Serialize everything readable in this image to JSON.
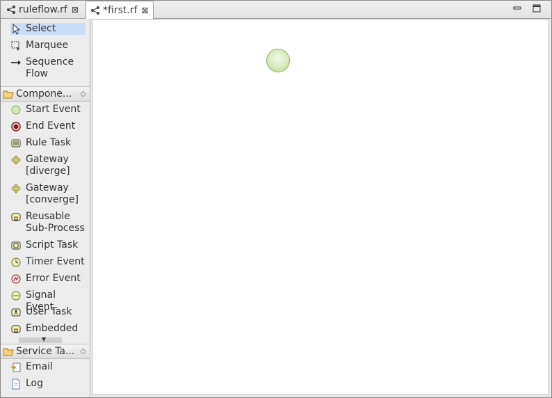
{
  "tabs": [
    {
      "label": "ruleflow.rf",
      "active": false,
      "icon": "flow-icon",
      "close": "⊠"
    },
    {
      "label": "*first.rf",
      "active": true,
      "icon": "flow-icon",
      "close": "⊠"
    }
  ],
  "window_controls": {
    "minimize_icon": "minimize-icon",
    "maximize_icon": "maximize-icon"
  },
  "palette": {
    "tools": [
      {
        "label": "Select",
        "icon": "select-arrow-icon",
        "selected": true
      },
      {
        "label": "Marquee",
        "icon": "marquee-icon"
      },
      {
        "label": "Sequence Flow",
        "icon": "sequence-flow-icon"
      }
    ],
    "components_drawer": {
      "label": "Compone...",
      "icon": "folder-icon"
    },
    "components": [
      {
        "label": "Start Event",
        "icon": "start-event-icon"
      },
      {
        "label": "End Event",
        "icon": "end-event-icon"
      },
      {
        "label": "Rule Task",
        "icon": "rule-task-icon"
      },
      {
        "label": "Gateway [diverge]",
        "icon": "gateway-diverge-icon"
      },
      {
        "label": "Gateway [converge]",
        "icon": "gateway-converge-icon"
      },
      {
        "label": "Reusable Sub-Process",
        "icon": "reusable-subprocess-icon"
      },
      {
        "label": "Script Task",
        "icon": "script-task-icon"
      },
      {
        "label": "Timer Event",
        "icon": "timer-event-icon"
      },
      {
        "label": "Error Event",
        "icon": "error-event-icon"
      },
      {
        "label": "Signal Event",
        "icon": "signal-event-icon"
      },
      {
        "label": "User Task",
        "icon": "user-task-icon"
      },
      {
        "label": "Embedded",
        "icon": "embedded-subprocess-icon"
      }
    ],
    "service_drawer": {
      "label": "Service Ta...",
      "icon": "folder-icon"
    },
    "services": [
      {
        "label": "Email",
        "icon": "email-icon"
      },
      {
        "label": "Log",
        "icon": "log-icon"
      }
    ]
  },
  "canvas": {
    "nodes": [
      {
        "type": "start-event"
      }
    ]
  }
}
